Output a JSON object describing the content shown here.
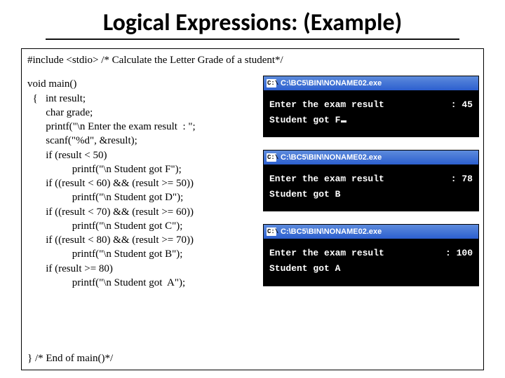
{
  "title": "Logical Expressions: (Example)",
  "include_line": "#include <stdio>  /* Calculate the Letter Grade of a student*/",
  "code": "void main()\n  {   int result;\n       char grade;\n       printf(\"\\n Enter the exam result  : \";\n       scanf(\"%d\", &result);\n       if (result < 50)\n                 printf(\"\\n Student got F\");\n       if ((result < 60) && (result >= 50))\n                 printf(\"\\n Student got D\");\n       if ((result < 70) && (result >= 60))\n                 printf(\"\\n Student got C\");\n       if ((result < 80) && (result >= 70))\n                 printf(\"\\n Student got B\");\n       if (result >= 80)\n                 printf(\"\\n Student got  A\");",
  "footer": "} /* End of main()*/",
  "consoles": [
    {
      "title": "C:\\BC5\\BIN\\NONAME02.exe",
      "icon": "C:\\",
      "prompt": "Enter the exam result",
      "input": ": 45",
      "output": "Student got F",
      "show_cursor": true
    },
    {
      "title": "C:\\BC5\\BIN\\NONAME02.exe",
      "icon": "C:\\",
      "prompt": "Enter the exam result",
      "input": ": 78",
      "output": "Student got B",
      "show_cursor": false
    },
    {
      "title": "C:\\BC5\\BIN\\NONAME02.exe",
      "icon": "C:\\",
      "prompt": "Enter the exam result",
      "input": ": 100",
      "output": "Student got  A",
      "show_cursor": false
    }
  ]
}
